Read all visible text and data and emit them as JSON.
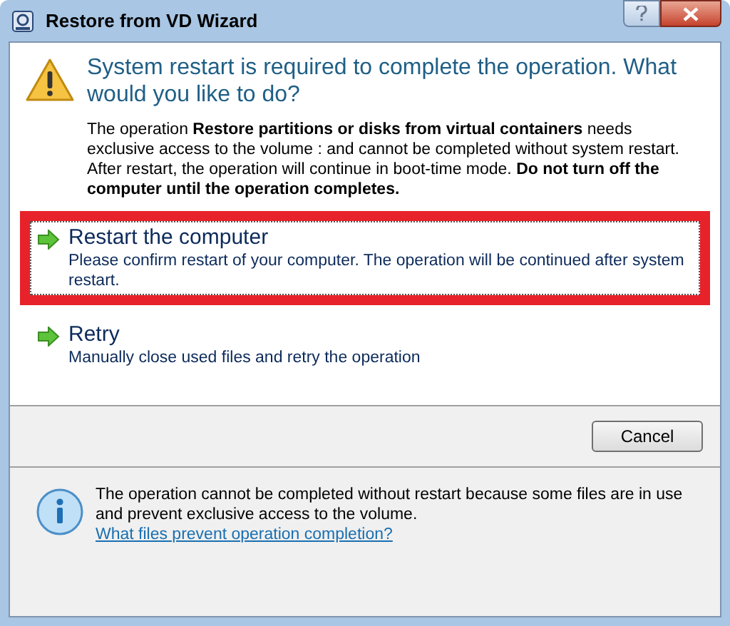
{
  "window": {
    "title": "Restore from VD Wizard"
  },
  "heading": "System restart is required to complete the operation. What would you like to do?",
  "description": "The operation **Restore partitions or disks from virtual containers** needs exclusive access to the volume : and cannot be completed without system restart. After restart, the operation will continue in boot-time mode. **Do not turn off the computer until the operation completes.**",
  "options": [
    {
      "label": "Restart the computer",
      "detail": "Please confirm restart of your computer. The operation will be continued after system restart.",
      "focused": true,
      "highlighted": true
    },
    {
      "label": "Retry",
      "detail": "Manually close used files and retry the operation",
      "focused": false,
      "highlighted": false
    }
  ],
  "buttons": [
    "Cancel"
  ],
  "info": {
    "text": "The operation cannot be completed without restart because some files are in use and prevent exclusive access to the volume.",
    "link": "What files prevent operation completion?"
  }
}
